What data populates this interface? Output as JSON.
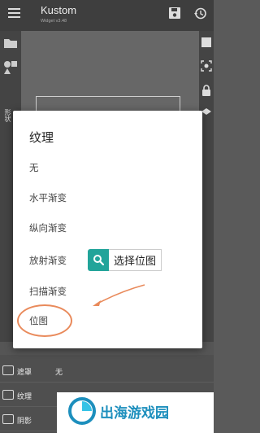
{
  "app": {
    "title": "Kustom",
    "subtitle": "Widget v3.48"
  },
  "sidebar": {
    "vertical_label": "形状"
  },
  "dialog": {
    "title": "纹理",
    "options": [
      "无",
      "水平渐变",
      "纵向渐变",
      "放射渐变",
      "扫描渐变",
      "位图"
    ]
  },
  "annotation": {
    "callout": "选择位图"
  },
  "bottom_rows": [
    {
      "label": "遮罩",
      "value": "无"
    },
    {
      "label": "纹理",
      "value": ""
    },
    {
      "label": "阴影",
      "value": ""
    }
  ],
  "watermark": {
    "text": "出海游戏园"
  },
  "colors": {
    "accent_teal": "#22a49a",
    "annotation_orange": "#e98a5b",
    "watermark_blue": "#1d8fbd"
  }
}
